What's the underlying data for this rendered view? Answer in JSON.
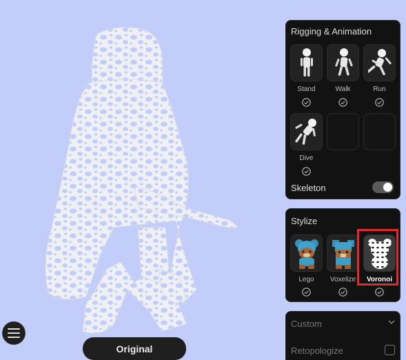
{
  "viewport": {
    "view_button_label": "Original",
    "menu_icon": "hamburger-icon",
    "background_color": "#c3cdfa",
    "model": "voronoi-lattice-character"
  },
  "rigging": {
    "title": "Rigging & Animation",
    "items": [
      {
        "label": "Stand",
        "icon": "stand-pose-icon"
      },
      {
        "label": "Walk",
        "icon": "walk-pose-icon"
      },
      {
        "label": "Run",
        "icon": "run-pose-icon"
      },
      {
        "label": "Dive",
        "icon": "dive-pose-icon"
      }
    ],
    "skeleton_label": "Skeleton",
    "skeleton_on": true
  },
  "stylize": {
    "title": "Stylize",
    "items": [
      {
        "label": "Lego",
        "icon": "lego-bear-icon"
      },
      {
        "label": "Voxelize",
        "icon": "voxel-bear-icon"
      },
      {
        "label": "Voronoi",
        "icon": "voronoi-bear-icon"
      }
    ],
    "selected": "Voronoi",
    "highlight_color": "#e32b2b"
  },
  "custom": {
    "label": "Custom",
    "retopologize_label": "Retopologize"
  }
}
